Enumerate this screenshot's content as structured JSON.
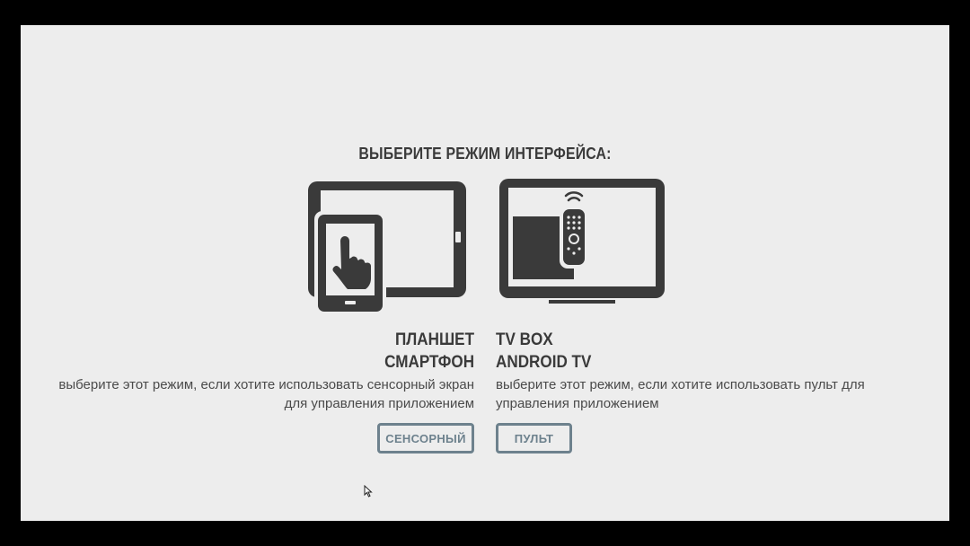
{
  "screen": {
    "title": "ВЫБЕРИТЕ РЕЖИМ ИНТЕРФЕЙСА:"
  },
  "modes": [
    {
      "icon": "tablet-touch-icon",
      "name_line1": "ПЛАНШЕТ",
      "name_line2": "СМАРТФОН",
      "desc_line1": "выберите этот режим, если хотите использовать сенсорный экран",
      "desc_line2": "для управления приложением",
      "button_label": "СЕНСОРНЫЙ"
    },
    {
      "icon": "tv-remote-icon",
      "name_line1": "TV BOX",
      "name_line2": "ANDROID TV",
      "desc_line1": "выберите этот режим, если хотите использовать пульт для",
      "desc_line2": "управления приложением",
      "button_label": "ПУЛЬТ"
    }
  ],
  "colors": {
    "background": "#ededed",
    "icon": "#3a3a3a",
    "button": "#6d818d",
    "frame": "#000000"
  }
}
